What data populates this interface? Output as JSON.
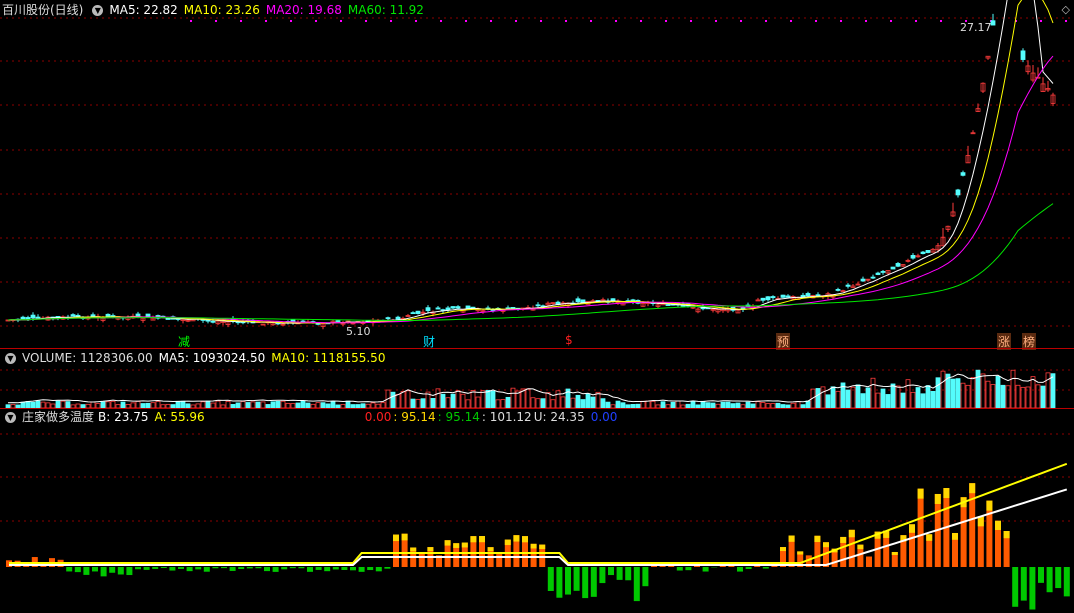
{
  "price_panel": {
    "stock_name": "百川股份(日线)",
    "ma5": "MA5: 22.82",
    "ma10": "MA10: 23.26",
    "ma20": "MA20: 19.68",
    "ma60": "MA60: 11.92",
    "high_label": "27.17",
    "low_label": "5.10",
    "events": [
      "减",
      "财",
      "$",
      "预",
      "涨",
      "榜"
    ]
  },
  "volume_panel": {
    "label": "VOLUME: 1128306.00",
    "ma5": "MA5: 1093024.50",
    "ma10": "MA10: 1118155.50"
  },
  "indicator_panel": {
    "name": "庄家做多温度",
    "b": "B: 23.75",
    "a": "A: 55.96",
    "v1": "0.00",
    "v2": ": 95.14",
    "v3": ": 95.14",
    "v4": ": 101.12",
    "u": "U: 24.35",
    "v5": "0.00"
  },
  "colors": {
    "up": "#ff3c3c",
    "down": "#54fcfc",
    "ma5": "#ffffff",
    "ma10": "#ffff00",
    "ma20": "#ff00ff",
    "ma60": "#00e600",
    "grid": "#8b0000",
    "orange": "#ff5a00",
    "gold": "#ffd700",
    "green": "#00c800",
    "blue": "#4aa0ff"
  }
}
